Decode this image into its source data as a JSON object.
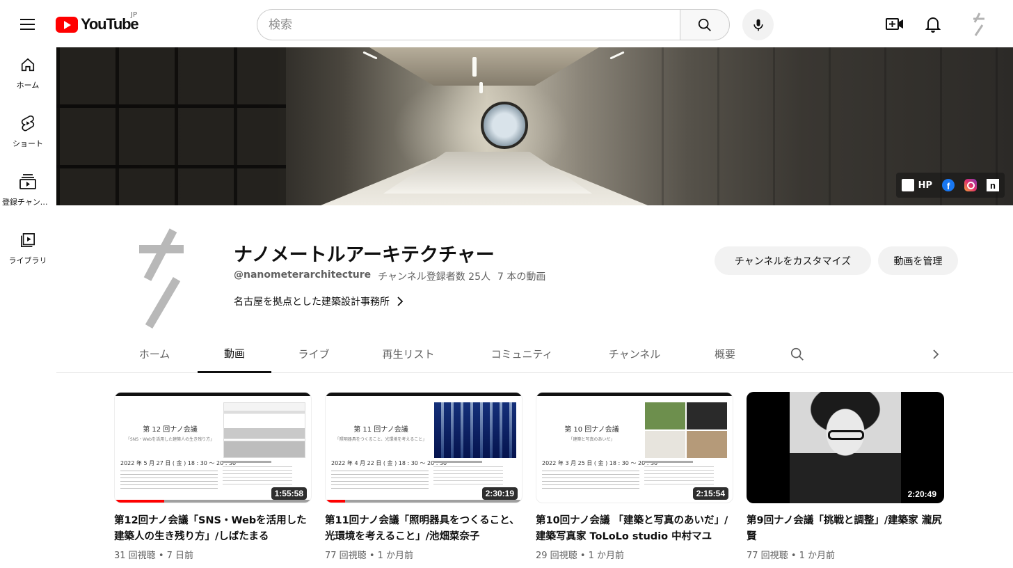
{
  "header": {
    "logo_text": "YouTube",
    "country": "JP",
    "search_placeholder": "検索"
  },
  "sidebar": {
    "items": [
      {
        "label": "ホーム",
        "icon": "home-icon"
      },
      {
        "label": "ショート",
        "icon": "shorts-icon"
      },
      {
        "label": "登録チャンネル",
        "icon": "subscriptions-icon"
      },
      {
        "label": "ライブラリ",
        "icon": "library-icon"
      }
    ]
  },
  "banner": {
    "links": [
      {
        "label": "HP"
      },
      {
        "label": ""
      },
      {
        "label": ""
      },
      {
        "label": ""
      }
    ]
  },
  "channel": {
    "name": "ナノメートルアーキテクチャー",
    "handle": "@nanometerarchitecture",
    "subscribers": "チャンネル登録者数 25人",
    "video_count": "7 本の動画",
    "description": "名古屋を拠点とした建築設計事務所",
    "customize_label": "チャンネルをカスタマイズ",
    "manage_label": "動画を管理"
  },
  "tabs": [
    {
      "label": "ホーム",
      "active": false
    },
    {
      "label": "動画",
      "active": true
    },
    {
      "label": "ライブ",
      "active": false
    },
    {
      "label": "再生リスト",
      "active": false
    },
    {
      "label": "コミュニティ",
      "active": false
    },
    {
      "label": "チャンネル",
      "active": false
    },
    {
      "label": "概要",
      "active": false
    }
  ],
  "videos": [
    {
      "title": "第12回ナノ会議「SNS・Webを活用した建築人の生き残り方」/しばたまる",
      "views": "31 回視聴",
      "age": "7 日前",
      "duration": "1:55:58",
      "progress": 0.25,
      "thumb_title": "第 12 回ナノ会議",
      "thumb_sub": "「SNS・Webを活用した建築人の生き残り方」",
      "thumb_date": "2022 年 5 月 27 日 ( 金 ) 18 : 30 〜 20 : 30"
    },
    {
      "title": "第11回ナノ会議「照明器具をつくること、光環境を考えること」/池畑菜奈子",
      "views": "77 回視聴",
      "age": "1 か月前",
      "duration": "2:30:19",
      "progress": 0.1,
      "thumb_title": "第 11 回ナノ会議",
      "thumb_sub": "「照明器具をつくること、光環境を考えること」",
      "thumb_date": "2022 年 4 月 22 日 ( 金 ) 18 : 30 〜 20 : 30"
    },
    {
      "title": "第10回ナノ会議 「建築と写真のあいだ」/建築写真家 ToLoLo studio 中村マユ",
      "views": "29 回視聴",
      "age": "1 か月前",
      "duration": "2:15:54",
      "progress": 0,
      "thumb_title": "第 10 回ナノ会議",
      "thumb_sub": "「建築と写真のあいだ」",
      "thumb_date": "2022 年 3 月 25 日 ( 金 ) 18 : 30 〜 20 : 30"
    },
    {
      "title": "第9回ナノ会議「挑戦と調整」/建築家 瀧尻賢",
      "views": "77 回視聴",
      "age": "1 か月前",
      "duration": "2:20:49",
      "progress": 0
    }
  ],
  "colors": {
    "brand_red": "#ff0000",
    "text_primary": "#0f0f0f",
    "text_secondary": "#606060",
    "pill_bg": "#f2f2f2"
  }
}
